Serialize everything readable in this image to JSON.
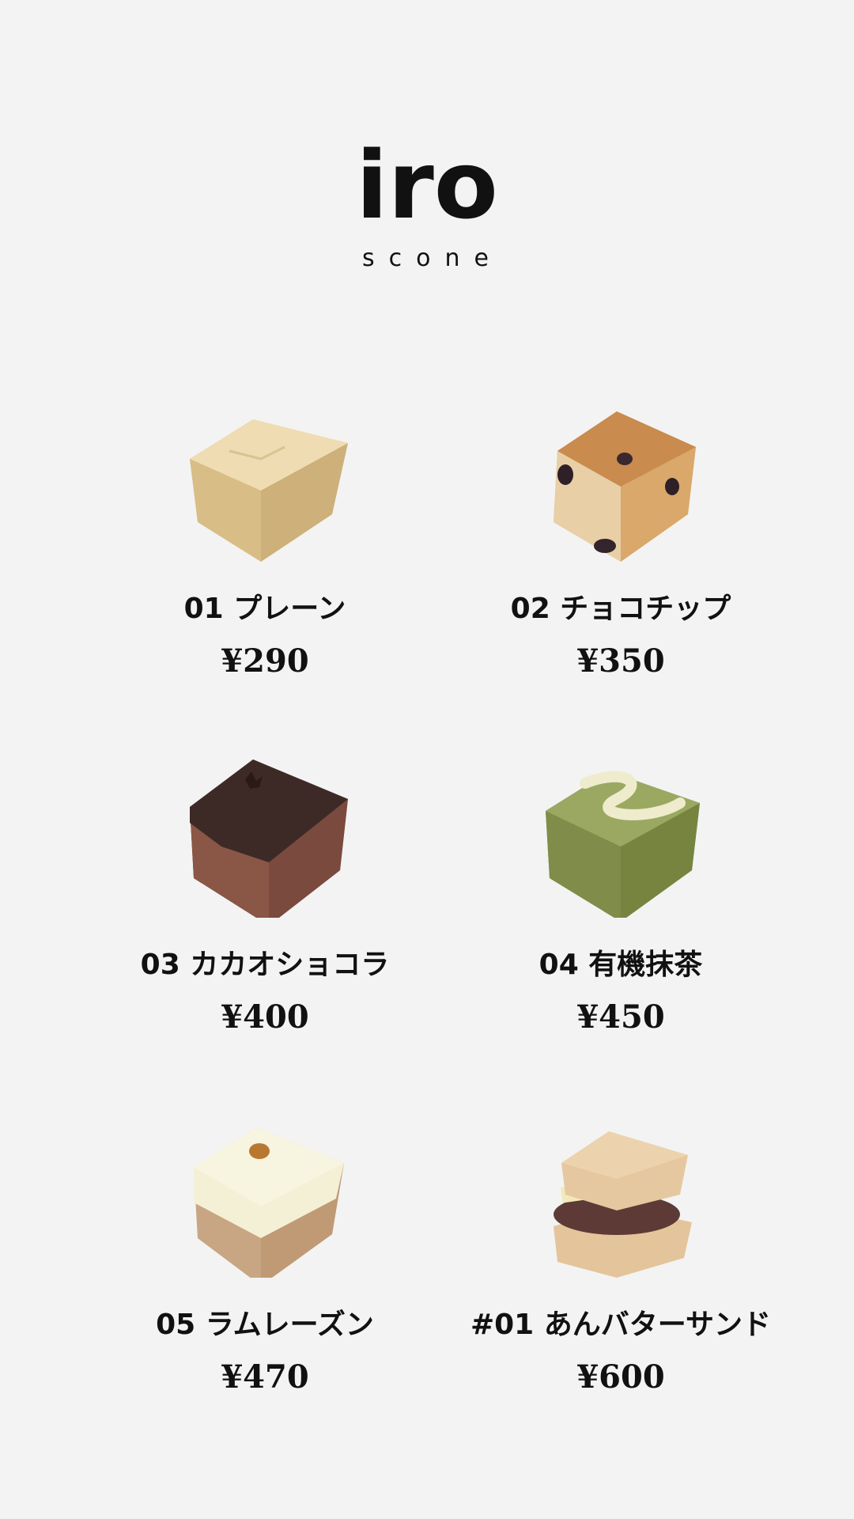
{
  "brand": {
    "logo_text": "iro",
    "logo_subtitle": "scone"
  },
  "products": [
    {
      "name": "01 プレーン",
      "price": "¥290",
      "image": "plain-scone-photo"
    },
    {
      "name": "02 チョコチップ",
      "price": "¥350",
      "image": "chocolate-chip-scone-photo"
    },
    {
      "name": "03 カカオショコラ",
      "price": "¥400",
      "image": "cacao-chocolat-scone-photo"
    },
    {
      "name": "04 有機抹茶",
      "price": "¥450",
      "image": "organic-matcha-scone-photo"
    },
    {
      "name": "05 ラムレーズン",
      "price": "¥470",
      "image": "rum-raisin-scone-photo"
    },
    {
      "name": "#01 あんバターサンド",
      "price": "¥600",
      "image": "anko-butter-sandwich-photo"
    }
  ]
}
